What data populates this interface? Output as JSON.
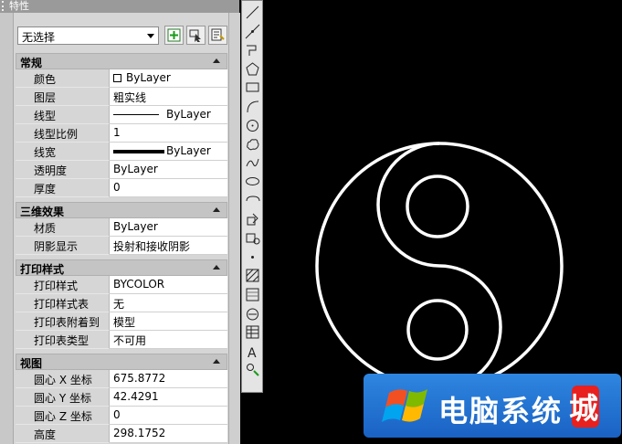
{
  "palette": {
    "title": "特性",
    "selection": "无选择",
    "tools": [
      "add-selection-icon",
      "quick-select-icon",
      "toggle-pickadd-icon"
    ],
    "sections": [
      {
        "label": "常规",
        "rows": [
          {
            "key": "颜色",
            "value": "ByLayer",
            "icon": "color-swatch-icon"
          },
          {
            "key": "图层",
            "value": "粗实线"
          },
          {
            "key": "线型",
            "value": "ByLayer",
            "icon": "linetype-preview-icon"
          },
          {
            "key": "线型比例",
            "value": "1"
          },
          {
            "key": "线宽",
            "value": "ByLayer",
            "icon": "lineweight-preview-icon"
          },
          {
            "key": "透明度",
            "value": "ByLayer"
          },
          {
            "key": "厚度",
            "value": "0"
          }
        ]
      },
      {
        "label": "三维效果",
        "rows": [
          {
            "key": "材质",
            "value": "ByLayer"
          },
          {
            "key": "阴影显示",
            "value": "投射和接收阴影"
          }
        ]
      },
      {
        "label": "打印样式",
        "rows": [
          {
            "key": "打印样式",
            "value": "BYCOLOR"
          },
          {
            "key": "打印样式表",
            "value": "无"
          },
          {
            "key": "打印表附着到",
            "value": "模型"
          },
          {
            "key": "打印表类型",
            "value": "不可用"
          }
        ]
      },
      {
        "label": "视图",
        "rows": [
          {
            "key": "圆心 X 坐标",
            "value": "675.8772"
          },
          {
            "key": "圆心 Y 坐标",
            "value": "42.4291"
          },
          {
            "key": "圆心 Z 坐标",
            "value": "0"
          },
          {
            "key": "高度",
            "value": "298.1752"
          }
        ]
      }
    ]
  },
  "draw_toolbar": {
    "tools": [
      "line-icon",
      "construction-line-icon",
      "polyline-icon",
      "polygon-icon",
      "rectangle-icon",
      "arc-icon",
      "circle-icon",
      "revision-cloud-icon",
      "spline-icon",
      "ellipse-icon",
      "ellipse-arc-icon",
      "insert-block-icon",
      "make-block-icon",
      "point-icon",
      "hatch-icon",
      "gradient-icon",
      "region-icon",
      "table-icon",
      "multiline-text-icon",
      "add-selected-icon"
    ]
  },
  "canvas": {
    "background": "#000000",
    "drawing": "yin-yang-symbol"
  },
  "watermark": {
    "text": "电脑系统",
    "badge": "城",
    "color": "#2e86e0"
  }
}
